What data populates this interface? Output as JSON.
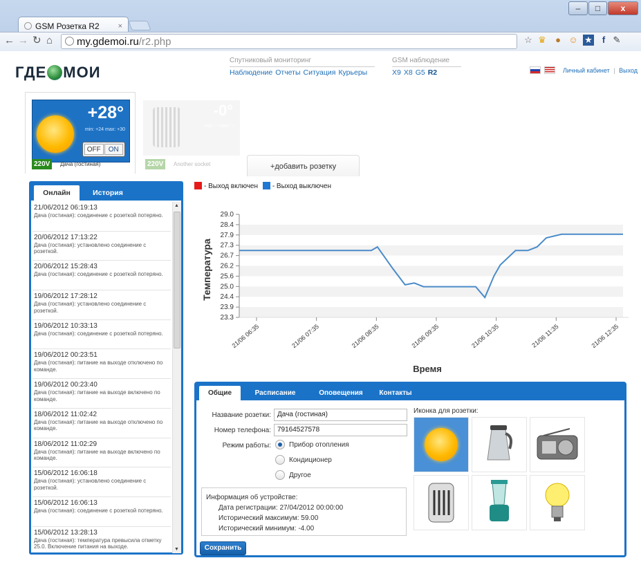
{
  "browser": {
    "tab_title": "GSM Розетка R2",
    "tab_close": "×",
    "url_host": "my.gdemoi.ru",
    "url_path": "/r2.php",
    "win_minimize": "–",
    "win_maximize": "□",
    "win_close": "x"
  },
  "header": {
    "logo": "ГДЕМОИ",
    "logo_left": "ГДЕ",
    "logo_right": "МОИ",
    "sat_title": "Спутниковый мониторинг",
    "sat_links": [
      "Наблюдение",
      "Отчеты",
      "Ситуация",
      "Курьеры"
    ],
    "gsm_title": "GSM наблюдение",
    "gsm_links": [
      "X9",
      "X8",
      "G5",
      "R2"
    ],
    "account": "Личный кабинет",
    "separator": "|",
    "logout": "Выход"
  },
  "sockets": [
    {
      "temp": "+28°",
      "minmax": "min: +24 max: +30",
      "off": "OFF",
      "on": "ON",
      "voltage": "220V",
      "name": "Дача (гостиная)",
      "voltage_color": "#2a8a1e"
    },
    {
      "temp": "-0°",
      "minmax": "min: -- max: --",
      "voltage": "220V",
      "name": "Another socket"
    }
  ],
  "add_socket": "+добавить розетку",
  "left_tabs": [
    "Онлайн",
    "История"
  ],
  "log": [
    {
      "time": "21/06/2012 06:19:13",
      "msg": "Дача (гостиная): соединение с розеткой потеряно."
    },
    {
      "time": "20/06/2012 17:13:22",
      "msg": "Дача (гостиная): установлено соединение с розеткой."
    },
    {
      "time": "20/06/2012 15:28:43",
      "msg": "Дача (гостиная): соединение с розеткой потеряно."
    },
    {
      "time": "19/06/2012 17:28:12",
      "msg": "Дача (гостиная): установлено соединение с розеткой."
    },
    {
      "time": "19/06/2012 10:33:13",
      "msg": "Дача (гостиная): соединение с розеткой потеряно."
    },
    {
      "time": "19/06/2012 00:23:51",
      "msg": "Дача (гостиная): питание на выходе отключено по команде."
    },
    {
      "time": "19/06/2012 00:23:40",
      "msg": "Дача (гостиная): питание на выходе включено по команде."
    },
    {
      "time": "18/06/2012 11:02:42",
      "msg": "Дача (гостиная): питание на выходе отключено по команде."
    },
    {
      "time": "18/06/2012 11:02:29",
      "msg": "Дача (гостиная): питание на выходе включено по команде."
    },
    {
      "time": "15/06/2012 16:06:18",
      "msg": "Дача (гостиная): установлено соединение с розеткой."
    },
    {
      "time": "15/06/2012 16:06:13",
      "msg": "Дача (гостиная): соединение с розеткой потеряно."
    },
    {
      "time": "15/06/2012 13:28:13",
      "msg": "Дача (гостиная): температура превысила отметку 25.0. Включение питания на выходе."
    }
  ],
  "chart_data": {
    "type": "line",
    "legend": [
      {
        "label": "- Выход включен",
        "color": "#e51b1b"
      },
      {
        "label": "- Выход выключен",
        "color": "#1f78d1"
      }
    ],
    "xlabel": "Время",
    "ylabel": "Температура",
    "ylim": [
      23.3,
      29.0
    ],
    "yticks": [
      "29.0",
      "28.4",
      "27.9",
      "27.3",
      "26.7",
      "26.2",
      "25.6",
      "25.0",
      "24.4",
      "23.9",
      "23.3"
    ],
    "xticks": [
      "21/06 06:35",
      "21/06 07:35",
      "21/06 08:35",
      "21/06 09:35",
      "21/06 10:35",
      "21/06 11:35",
      "21/06 12:35"
    ],
    "grid": "horizontal bands",
    "line_color": "#4a8bc9",
    "x_hours": [
      6.5,
      7.0,
      7.5,
      8.0,
      8.5,
      8.65,
      8.75,
      9.0,
      9.2,
      9.35,
      9.5,
      9.75,
      10.0,
      10.25,
      10.35,
      10.5,
      10.65,
      10.75,
      11.0,
      11.2,
      11.35,
      11.5,
      11.75,
      12.0,
      12.25,
      12.5,
      12.75
    ],
    "y": [
      27.0,
      27.0,
      27.0,
      27.0,
      27.0,
      27.0,
      27.2,
      26.0,
      25.1,
      25.2,
      25.0,
      25.0,
      25.0,
      25.0,
      25.0,
      24.4,
      25.6,
      26.2,
      27.0,
      27.0,
      27.2,
      27.7,
      27.9,
      27.9,
      27.9,
      27.9,
      27.9
    ]
  },
  "settings": {
    "tabs": [
      "Общие",
      "Расписание",
      "Оповещения",
      "Контакты"
    ],
    "name_label": "Название розетки:",
    "name_value": "Дача (гостиная)",
    "phone_label": "Номер телефона:",
    "phone_value": "79164527578",
    "mode_label": "Режим работы:",
    "modes": [
      "Прибор отопления",
      "Кондиционер",
      "Другое"
    ],
    "mode_selected": 0,
    "info_title": "Информация об устройстве:",
    "info_reg": "Дата регистрации: 27/04/2012 00:00:00",
    "info_max": "Исторический максимум: 59.00",
    "info_min": "Исторический минимум: -4.00",
    "save": "Сохранить",
    "icon_label": "Иконка для розетки:",
    "icons": [
      "sun-icon",
      "kettle-icon",
      "radio-icon",
      "heater-icon",
      "blender-icon",
      "lightbulb-icon"
    ],
    "icon_selected": 0
  }
}
